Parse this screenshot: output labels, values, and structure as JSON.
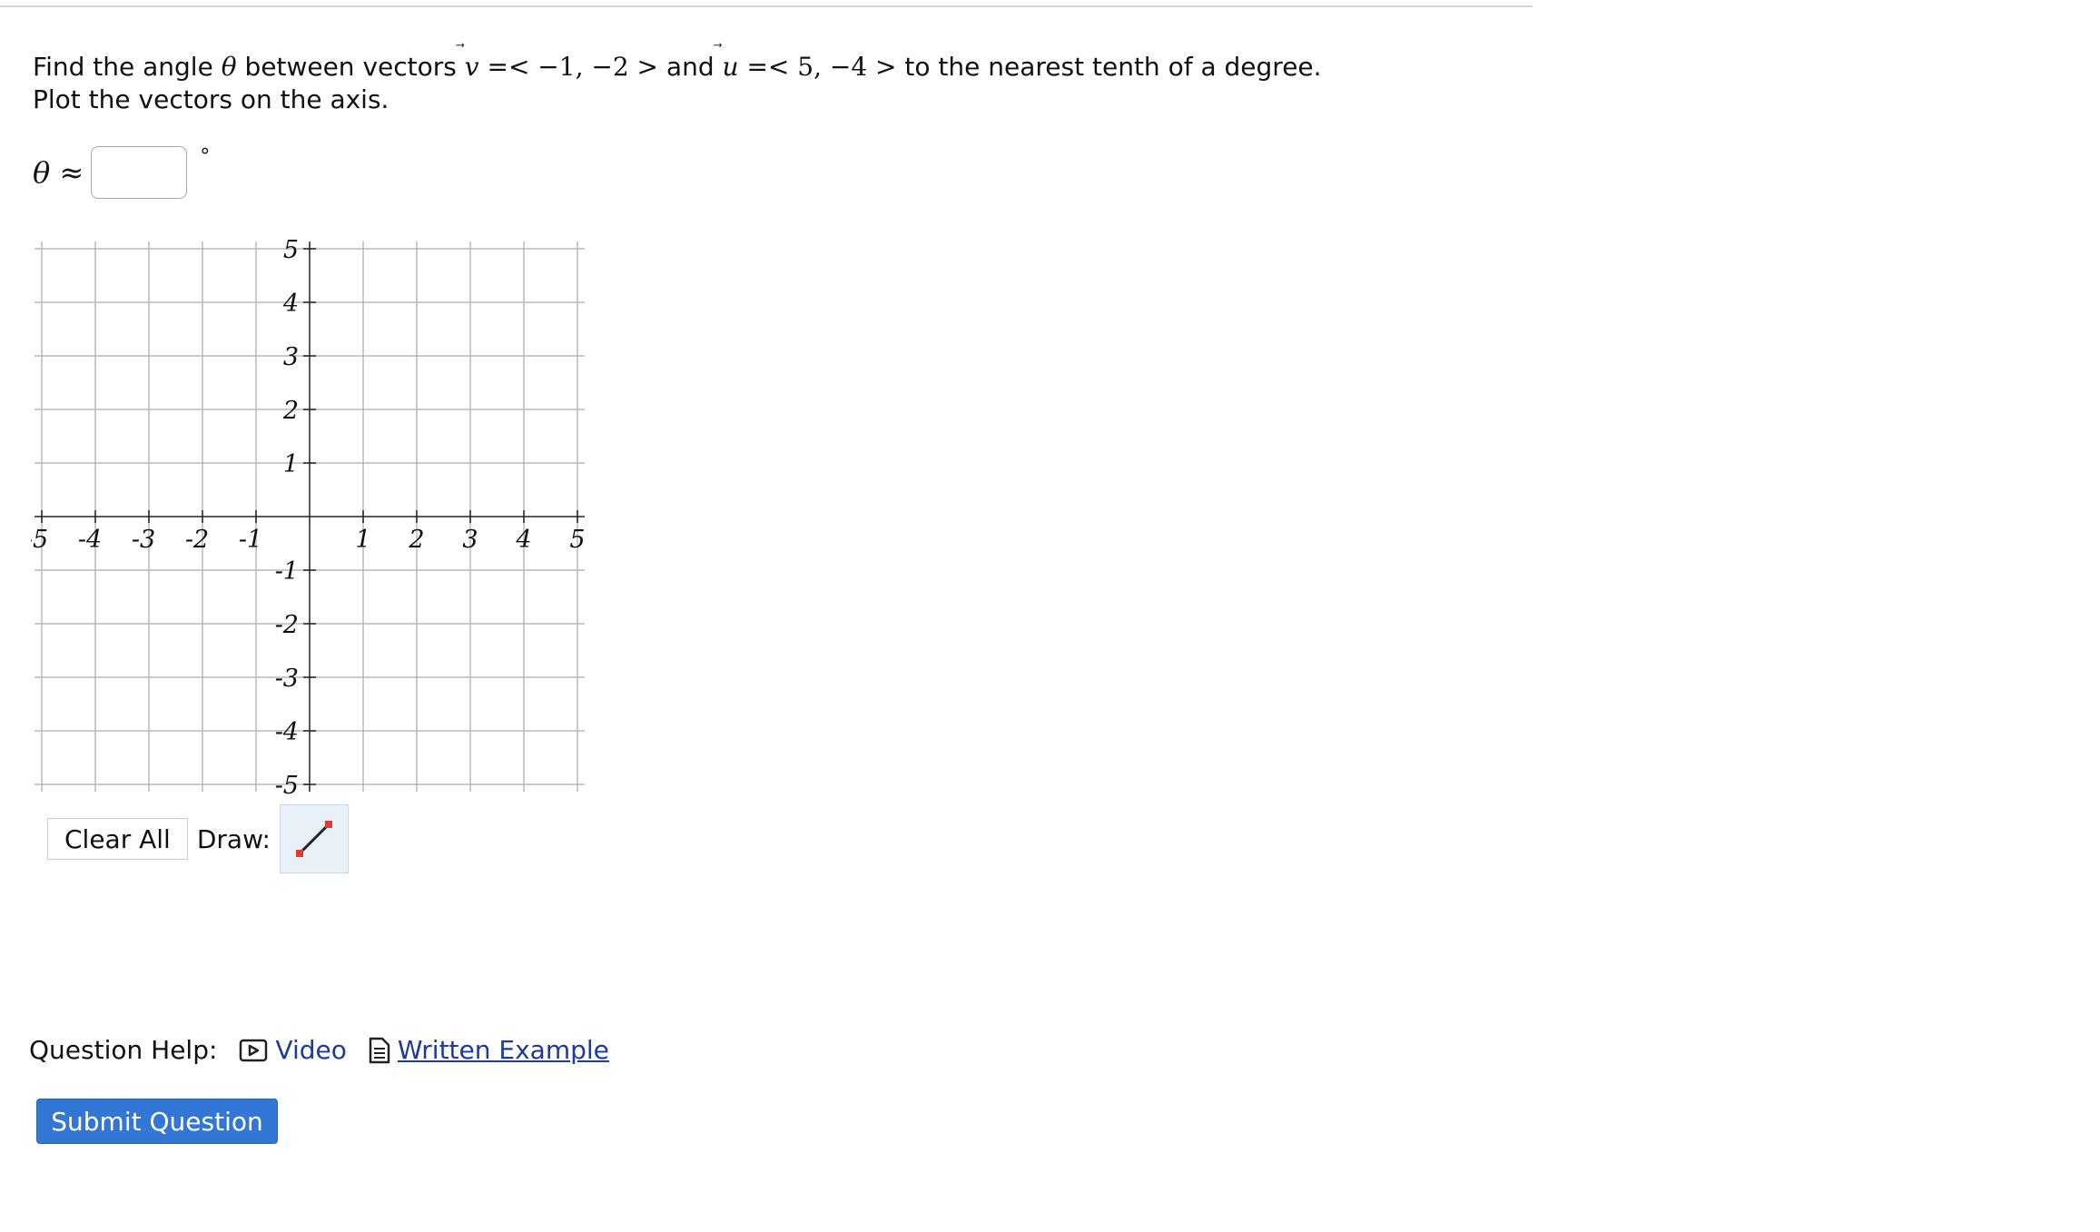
{
  "question": {
    "intro": "Find the angle ",
    "theta": "θ",
    "between": " between vectors ",
    "v_name": "v",
    "v_value": " =< −1, −2 > ",
    "and": "and ",
    "u_name": "u",
    "u_value": " =< 5, −4 > ",
    "tail": "to the nearest tenth of a degree.",
    "line2": "Plot the vectors on the axis."
  },
  "answer": {
    "label": "θ ≈",
    "value": "",
    "unit": "°"
  },
  "graph": {
    "x_ticks": [
      "-5",
      "-4",
      "-3",
      "-2",
      "-1",
      "1",
      "2",
      "3",
      "4",
      "5"
    ],
    "y_ticks": [
      "5",
      "4",
      "3",
      "2",
      "1",
      "-1",
      "-2",
      "-3",
      "-4",
      "-5"
    ],
    "xlim": [
      -5,
      5
    ],
    "ylim": [
      -5,
      5
    ],
    "grid": true,
    "grid_color": "#b8b8b8",
    "axis_color": "#222222"
  },
  "controls": {
    "clear_label": "Clear All",
    "draw_label": "Draw:",
    "tool_icon": "vector-tool-icon"
  },
  "help": {
    "label": "Question Help:",
    "video_label": "Video",
    "example_label": "Written Example",
    "link_color": "#1d3a9c"
  },
  "submit": {
    "label": "Submit Question",
    "color": "#3377d6"
  }
}
